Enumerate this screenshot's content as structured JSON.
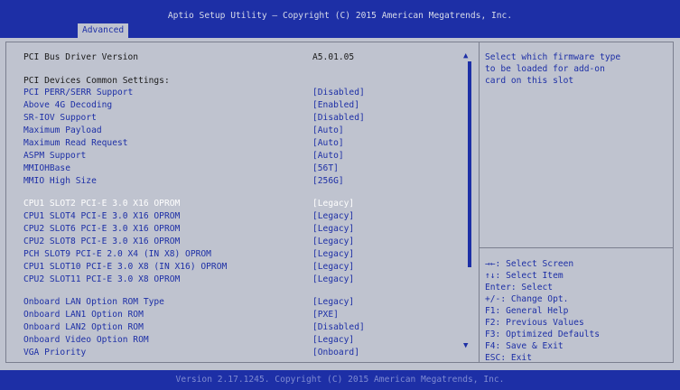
{
  "header": {
    "title": "Aptio Setup Utility – Copyright (C) 2015 American Megatrends, Inc.",
    "tab": "Advanced"
  },
  "items": [
    {
      "label": "PCI Bus Driver Version",
      "value": "A5.01.05"
    },
    {
      "label": "PCI Devices Common Settings:",
      "value": ""
    },
    {
      "label": "PCI PERR/SERR Support",
      "value": "[Disabled]"
    },
    {
      "label": "Above 4G Decoding",
      "value": "[Enabled]"
    },
    {
      "label": "SR-IOV Support",
      "value": "[Disabled]"
    },
    {
      "label": "Maximum Payload",
      "value": "[Auto]"
    },
    {
      "label": "Maximum Read Request",
      "value": "[Auto]"
    },
    {
      "label": "ASPM Support",
      "value": "[Auto]"
    },
    {
      "label": "MMIOHBase",
      "value": "[56T]"
    },
    {
      "label": "MMIO High Size",
      "value": "[256G]"
    },
    {
      "label": "CPU1 SLOT2 PCI-E 3.0 X16 OPROM",
      "value": "[Legacy]"
    },
    {
      "label": "CPU1 SLOT4 PCI-E 3.0 X16 OPROM",
      "value": "[Legacy]"
    },
    {
      "label": "CPU2 SLOT6 PCI-E 3.0 X16 OPROM",
      "value": "[Legacy]"
    },
    {
      "label": "CPU2 SLOT8 PCI-E 3.0 X16 OPROM",
      "value": "[Legacy]"
    },
    {
      "label": "PCH SLOT9 PCI-E 2.0 X4 (IN X8) OPROM",
      "value": "[Legacy]"
    },
    {
      "label": "CPU1 SLOT10 PCI-E 3.0 X8 (IN X16) OPROM",
      "value": "[Legacy]"
    },
    {
      "label": "CPU2 SLOT11 PCI-E 3.0 X8 OPROM",
      "value": "[Legacy]"
    },
    {
      "label": "Onboard LAN Option ROM Type",
      "value": "[Legacy]"
    },
    {
      "label": "Onboard LAN1 Option ROM",
      "value": "[PXE]"
    },
    {
      "label": "Onboard LAN2 Option ROM",
      "value": "[Disabled]"
    },
    {
      "label": "Onboard Video Option ROM",
      "value": "[Legacy]"
    },
    {
      "label": "VGA Priority",
      "value": "[Onboard]"
    }
  ],
  "help": [
    "Select which firmware type",
    "to be loaded for add-on",
    "card on this slot"
  ],
  "keys": [
    "→←: Select Screen",
    "↑↓: Select Item",
    "Enter: Select",
    "+/-: Change Opt.",
    "F1: General Help",
    "F2: Previous Values",
    "F3: Optimized Defaults",
    "F4: Save & Exit",
    "ESC: Exit"
  ],
  "footer": "Version 2.17.1245. Copyright (C) 2015 American Megatrends, Inc.",
  "colors": {
    "header_bg": "#1d2fa6",
    "body_bg": "#bfc3cf",
    "option_text": "#1d2fa6",
    "selected_text": "#ffffff",
    "static_text": "#1a1a1a"
  },
  "selected_item": "CPU1 SLOT2 PCI-E 3.0 X16 OPROM"
}
